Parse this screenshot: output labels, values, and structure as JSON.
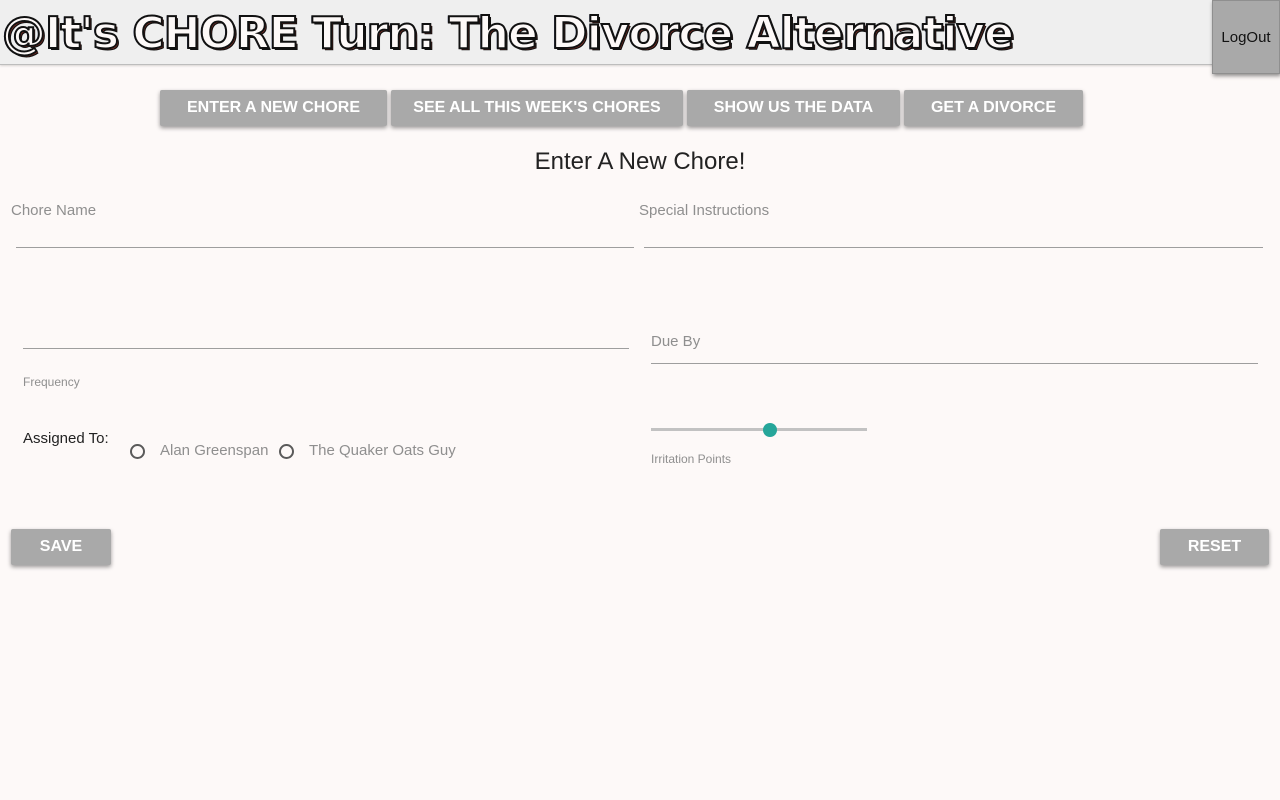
{
  "header": {
    "title": "@It's CHORE Turn: The Divorce Alternative",
    "logout_label": "LogOut"
  },
  "nav": {
    "items": [
      {
        "label": "ENTER A NEW CHORE"
      },
      {
        "label": "SEE ALL THIS WEEK'S CHORES"
      },
      {
        "label": "SHOW US THE DATA"
      },
      {
        "label": "GET A DIVORCE"
      }
    ]
  },
  "form": {
    "title": "Enter A New Chore!",
    "chore_name": {
      "label": "Chore Name",
      "value": ""
    },
    "special_instructions": {
      "label": "Special Instructions",
      "value": ""
    },
    "frequency": {
      "label": "Frequency",
      "value": ""
    },
    "due_by": {
      "label": "Due By",
      "value": ""
    },
    "assigned_to": {
      "label": "Assigned To:",
      "options": [
        "Alan Greenspan",
        "The Quaker Oats Guy"
      ],
      "selected": null
    },
    "irritation_points": {
      "label": "Irritation Points",
      "value_fraction": 0.55
    },
    "save_label": "SAVE",
    "reset_label": "RESET"
  },
  "colors": {
    "accent": "#26a69a",
    "button_bg": "#a9a9a9",
    "page_bg": "#fdf9f8"
  }
}
